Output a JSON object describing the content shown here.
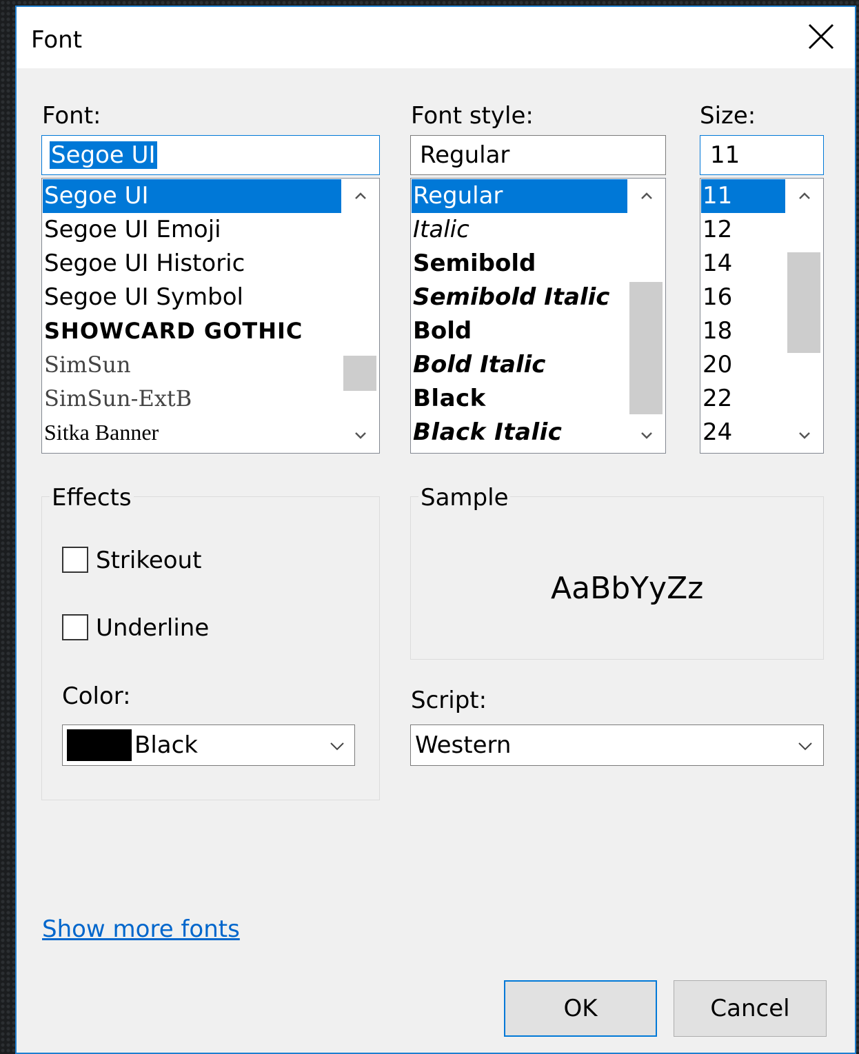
{
  "window": {
    "title": "Font",
    "close_icon": "close-icon"
  },
  "font": {
    "label": "Font:",
    "value": "Segoe UI",
    "items": [
      "Segoe UI",
      "Segoe UI Emoji",
      "Segoe UI Historic",
      "Segoe UI Symbol",
      "SHOWCARD GOTHIC",
      "SimSun",
      "SimSun-ExtB",
      "Sitka Banner"
    ],
    "selected": "Segoe UI"
  },
  "style": {
    "label": "Font style:",
    "value": "Regular",
    "items": [
      "Regular",
      "Italic",
      "Semibold",
      "Semibold Italic",
      "Bold",
      "Bold Italic",
      "Black",
      "Black Italic"
    ],
    "selected": "Regular"
  },
  "size": {
    "label": "Size:",
    "value": "11",
    "items": [
      "11",
      "12",
      "14",
      "16",
      "18",
      "20",
      "22",
      "24"
    ],
    "selected": "11"
  },
  "effects": {
    "title": "Effects",
    "strikeout": {
      "label": "Strikeout",
      "checked": false
    },
    "underline": {
      "label": "Underline",
      "checked": false
    },
    "color_label": "Color:",
    "color_value": "Black",
    "color_swatch": "#000000"
  },
  "sample": {
    "title": "Sample",
    "text": "AaBbYyZz"
  },
  "script": {
    "label": "Script:",
    "value": "Western"
  },
  "show_more_fonts": "Show more fonts",
  "buttons": {
    "ok": "OK",
    "cancel": "Cancel"
  },
  "colors": {
    "accent": "#0078d7",
    "dialog_bg": "#f0f0f0",
    "link": "#0066cc"
  }
}
